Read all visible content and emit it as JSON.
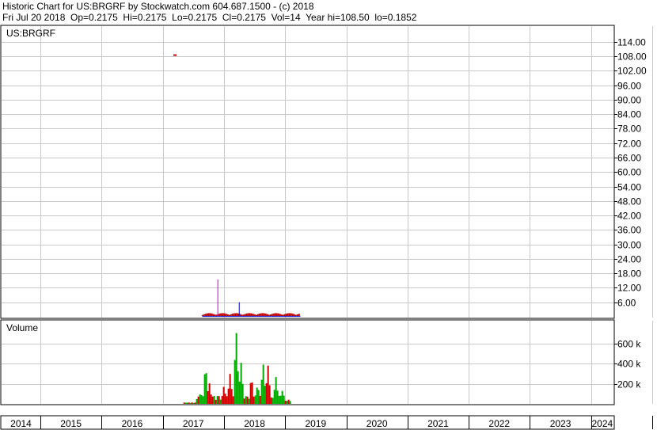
{
  "header": {
    "line1": "Historic Chart for US:BRGRF by Stockwatch.com 604.687.1500 - (c) 2018",
    "line2": "Fri Jul 20 2018  Op=0.2175  Hi=0.2175  Lo=0.2175  Cl=0.2175  Vol=14  Year hi=108.50  lo=0.1852"
  },
  "chart_data": [
    {
      "type": "bar",
      "title": "US:BRGRF",
      "ylim": [
        0,
        117
      ],
      "y_ticks": [
        "114.00",
        "108.00",
        "102.00",
        "96.00",
        "90.00",
        "84.00",
        "78.00",
        "72.00",
        "66.00",
        "60.00",
        "54.00",
        "48.00",
        "42.00",
        "36.00",
        "30.00",
        "24.00",
        "18.00",
        "12.00",
        "6.00"
      ],
      "x_ticks": [
        "2014",
        "2015",
        "2016",
        "2017",
        "2018",
        "2019",
        "2020",
        "2021",
        "2022",
        "2023",
        "2024"
      ],
      "grid": true,
      "colors": {
        "price": "#cc0000",
        "spike": "#cc00cc",
        "blue": "#0000cc",
        "up": "#00aa00",
        "down": "#cc0000"
      },
      "outlier": {
        "x": 2016.2,
        "y": 108.5
      },
      "spikes": [
        {
          "x": 2016.9,
          "low": 0.5,
          "high": 15.5,
          "color": "spike"
        },
        {
          "x": 2017.25,
          "low": 0.5,
          "high": 6.0,
          "color": "blue"
        }
      ],
      "price_band": {
        "x_start": 2016.65,
        "x_end": 2018.25,
        "low": 0.2,
        "high": 1.5
      }
    },
    {
      "type": "bar",
      "title": "Volume",
      "ylim": [
        0,
        820000
      ],
      "y_ticks": [
        "600 k",
        "400 k",
        "200 k"
      ],
      "y_tick_values": [
        600000,
        400000,
        200000
      ],
      "volume_range": {
        "x_start": 2016.35,
        "x_end": 2018.1
      },
      "peaks": [
        {
          "x": 2016.62,
          "value": 120000,
          "up": true
        },
        {
          "x": 2016.7,
          "value": 400000,
          "up": true
        },
        {
          "x": 2016.76,
          "value": 220000,
          "up": false
        },
        {
          "x": 2017.0,
          "value": 180000,
          "up": false
        },
        {
          "x": 2017.1,
          "value": 300000,
          "up": false
        },
        {
          "x": 2017.2,
          "value": 760000,
          "up": true
        },
        {
          "x": 2017.28,
          "value": 420000,
          "up": true
        },
        {
          "x": 2017.45,
          "value": 280000,
          "up": false
        },
        {
          "x": 2017.55,
          "value": 200000,
          "up": true
        },
        {
          "x": 2017.64,
          "value": 420000,
          "up": true
        },
        {
          "x": 2017.72,
          "value": 390000,
          "up": false
        },
        {
          "x": 2017.85,
          "value": 270000,
          "up": true
        },
        {
          "x": 2017.95,
          "value": 140000,
          "up": true
        }
      ]
    }
  ]
}
